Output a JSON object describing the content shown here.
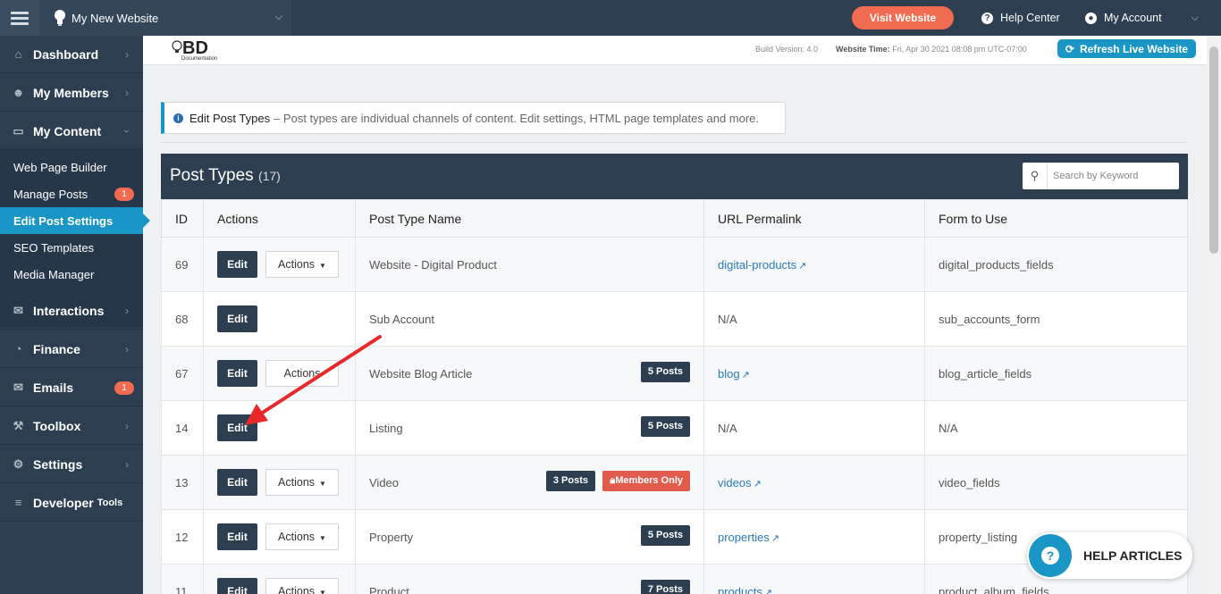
{
  "topbar": {
    "site_name": "My New Website",
    "visit_label": "Visit Website",
    "help_label": "Help Center",
    "account_label": "My Account"
  },
  "sidebar": {
    "items": [
      {
        "label": "Dashboard",
        "icon": "home-icon"
      },
      {
        "label": "My Members",
        "icon": "users-icon"
      },
      {
        "label": "My Content",
        "icon": "folder-open-icon"
      },
      {
        "label": "Interactions",
        "icon": "comments-icon"
      },
      {
        "label": "Finance",
        "icon": "pie-chart-icon"
      },
      {
        "label": "Emails",
        "icon": "envelope-icon",
        "badge": "1"
      },
      {
        "label": "Toolbox",
        "icon": "wrench-icon"
      },
      {
        "label": "Settings",
        "icon": "gear-icon"
      },
      {
        "label": "Developer",
        "suffix": "Tools",
        "icon": "sliders-icon"
      }
    ],
    "sub_items": [
      {
        "label": "Web Page Builder"
      },
      {
        "label": "Manage Posts",
        "badge": "1"
      },
      {
        "label": "Edit Post Settings",
        "active": true
      },
      {
        "label": "SEO Templates"
      },
      {
        "label": "Media Manager"
      }
    ]
  },
  "header": {
    "logo_text": "BD",
    "logo_sub": "Documentation",
    "build_version": "Build Version: 4.0",
    "website_time_label": "Website Time:",
    "website_time_value": "Fri, Apr 30 2021 08:08 pm UTC-07:00",
    "refresh_label": "Refresh Live Website"
  },
  "info": {
    "title": "Edit Post Types",
    "text": "– Post types are individual channels of content. Edit settings, HTML page templates and more."
  },
  "panel": {
    "title": "Post Types",
    "count": "(17)",
    "search_placeholder": "Search by Keyword"
  },
  "table": {
    "headers": [
      "ID",
      "Actions",
      "Post Type Name",
      "URL Permalink",
      "Form to Use"
    ],
    "edit_label": "Edit",
    "actions_label": "Actions",
    "rows": [
      {
        "id": "69",
        "name": "Website - Digital Product",
        "url": "digital-products",
        "form": "digital_products_fields",
        "actions": true
      },
      {
        "id": "68",
        "name": "Sub Account",
        "url": "N/A",
        "form": "sub_accounts_form",
        "actions": false
      },
      {
        "id": "67",
        "name": "Website Blog Article",
        "posts": "5 Posts",
        "url": "blog",
        "form": "blog_article_fields",
        "actions": true
      },
      {
        "id": "14",
        "name": "Listing",
        "posts": "5 Posts",
        "url": "N/A",
        "form": "N/A",
        "actions": false
      },
      {
        "id": "13",
        "name": "Video",
        "posts": "3 Posts",
        "members": "Members Only",
        "url": "videos",
        "form": "video_fields",
        "actions": true
      },
      {
        "id": "12",
        "name": "Property",
        "posts": "5 Posts",
        "url": "properties",
        "form": "property_listing",
        "actions": true
      },
      {
        "id": "11",
        "name": "Product",
        "posts": "7 Posts",
        "url": "products",
        "form": "product_album_fields",
        "actions": true
      }
    ]
  },
  "help_widget": {
    "label": "HELP ARTICLES"
  },
  "colors": {
    "navy": "#2d3e50",
    "accent_blue": "#1a96c6",
    "orange": "#f06b4f",
    "red_badge": "#e25c4e",
    "link_blue": "#2a7ab8",
    "annotation_arrow": "#e8282b"
  }
}
